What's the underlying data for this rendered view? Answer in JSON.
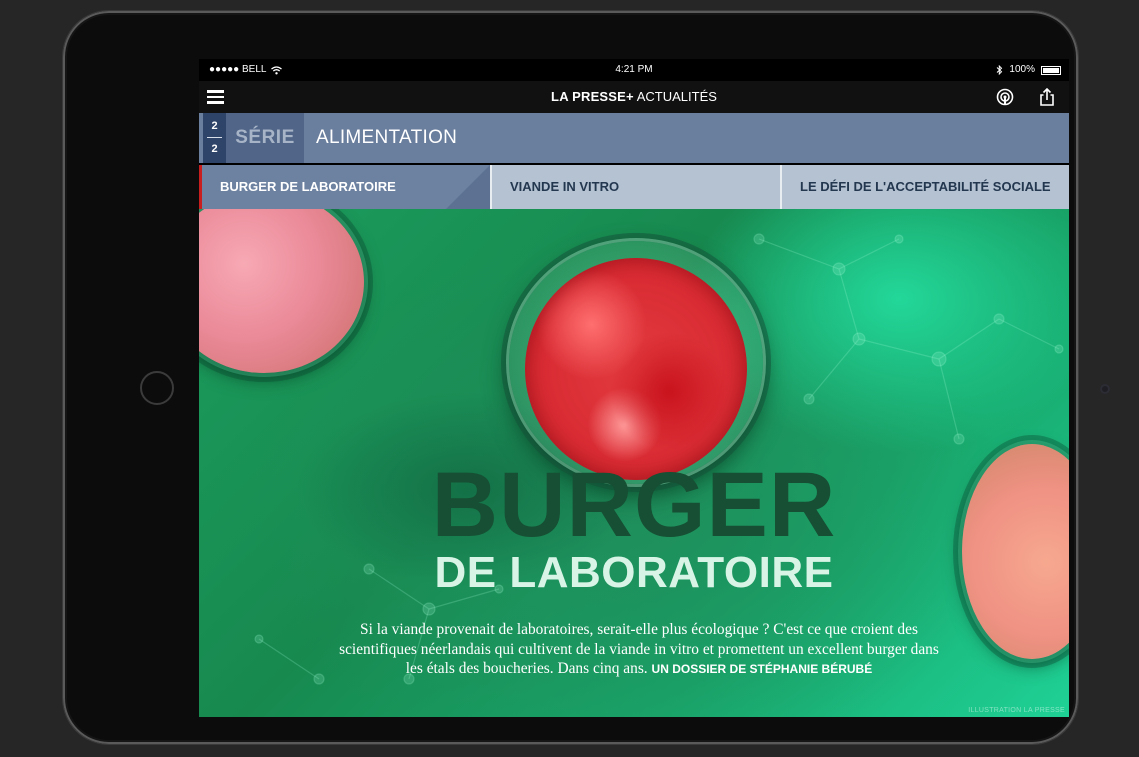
{
  "status_bar": {
    "carrier": "●●●●● BELL",
    "time": "4:21 PM",
    "battery": "100%"
  },
  "app_bar": {
    "brand": "LA PRESSE+",
    "section": "ACTUALITÉS"
  },
  "series": {
    "part_number": "2",
    "part_total": "2",
    "label": "SÉRIE",
    "title": "ALIMENTATION"
  },
  "tabs": [
    {
      "label": "BURGER DE LABORATOIRE",
      "active": true
    },
    {
      "label": "VIANDE IN VITRO",
      "active": false
    },
    {
      "label": "LE DÉFI DE L'ACCEPTABILITÉ SOCIALE",
      "active": false
    }
  ],
  "hero": {
    "headline": "BURGER",
    "subhead": "DE LABORATOIRE",
    "deck": "Si la viande provenait de laboratoires, serait-elle plus écologique ? C'est ce que croient des scientifiques néerlandais qui cultivent de la viande in vitro et promettent un excellent burger dans les étals des boucheries. Dans cinq ans.",
    "byline": "UN DOSSIER DE STÉPHANIE BÉRUBÉ",
    "credit": "ILLUSTRATION LA PRESSE"
  },
  "colors": {
    "series_bar": "#6a7e9d",
    "active_tab": "#6d82a1",
    "inactive_tab": "#b4c2d2",
    "accent_red": "#c81e1e",
    "hero_green": "#1c9d5e"
  }
}
